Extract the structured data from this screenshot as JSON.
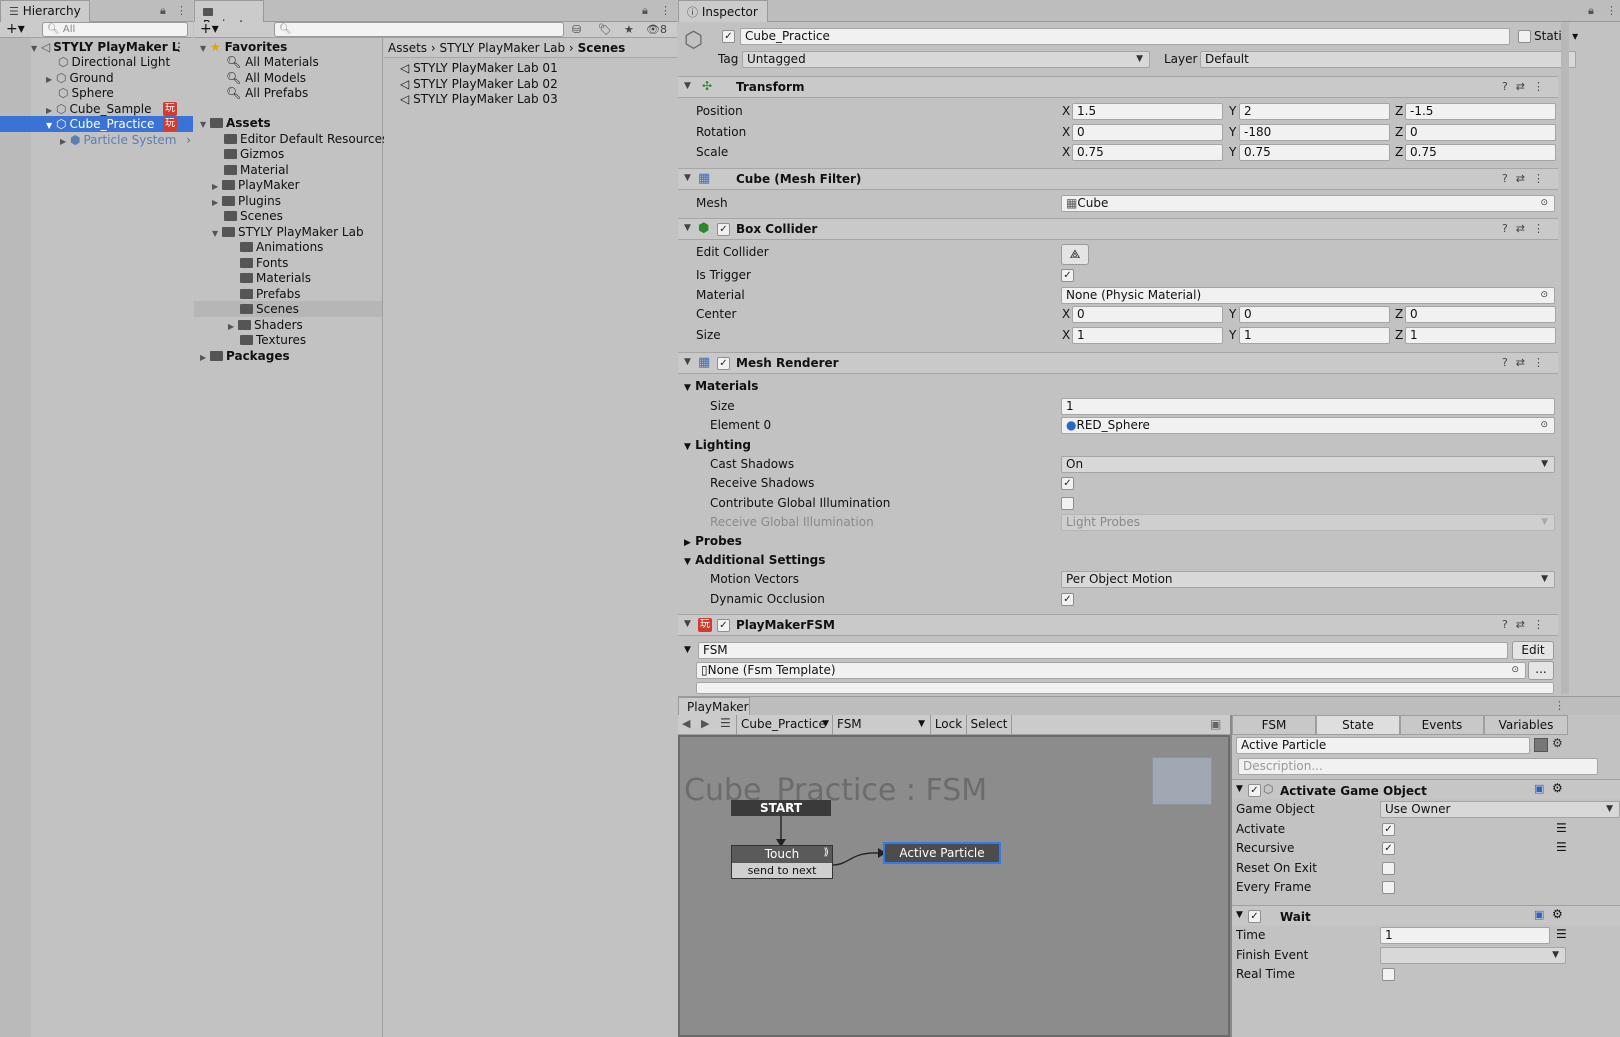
{
  "hierarchy": {
    "tab": "Hierarchy",
    "search_placeholder": "All",
    "items": [
      {
        "label": "STYLY PlayMaker L"
      },
      {
        "label": "Directional Light"
      },
      {
        "label": "Ground"
      },
      {
        "label": "Sphere"
      },
      {
        "label": "Cube_Sample",
        "badge": "玩"
      },
      {
        "label": "Cube_Practice",
        "badge": "玩"
      },
      {
        "label": "Particle System"
      }
    ]
  },
  "project": {
    "tab": "Project",
    "hidden_count": "8",
    "favorites": {
      "label": "Favorites",
      "items": [
        "All Materials",
        "All Models",
        "All Prefabs"
      ]
    },
    "assets": {
      "label": "Assets",
      "items": [
        "Editor Default Resources",
        "Gizmos",
        "Material",
        "PlayMaker",
        "Plugins",
        "Scenes",
        "STYLY PlayMaker Lab"
      ],
      "lab_children": [
        "Animations",
        "Fonts",
        "Materials",
        "Prefabs",
        "Scenes",
        "Shaders",
        "Textures"
      ]
    },
    "packages": "Packages",
    "breadcrumb": [
      "Assets",
      "STYLY PlayMaker Lab",
      "Scenes"
    ],
    "files": [
      "STYLY PlayMaker Lab 01",
      "STYLY PlayMaker Lab 02",
      "STYLY PlayMaker Lab 03"
    ]
  },
  "inspector": {
    "tab": "Inspector",
    "object_name": "Cube_Practice",
    "static_label": "Static",
    "tag_label": "Tag",
    "tag_value": "Untagged",
    "layer_label": "Layer",
    "layer_value": "Default",
    "transform": {
      "title": "Transform",
      "position_label": "Position",
      "rotation_label": "Rotation",
      "scale_label": "Scale",
      "position": [
        "1.5",
        "2",
        "-1.5"
      ],
      "rotation": [
        "0",
        "-180",
        "0"
      ],
      "scale": [
        "0.75",
        "0.75",
        "0.75"
      ]
    },
    "mesh_filter": {
      "title": "Cube (Mesh Filter)",
      "mesh_label": "Mesh",
      "mesh_value": "Cube"
    },
    "box_collider": {
      "title": "Box Collider",
      "edit_label": "Edit Collider",
      "trigger_label": "Is Trigger",
      "material_label": "Material",
      "material_value": "None (Physic Material)",
      "center_label": "Center",
      "center": [
        "0",
        "0",
        "0"
      ],
      "size_label": "Size",
      "size": [
        "1",
        "1",
        "1"
      ]
    },
    "mesh_renderer": {
      "title": "Mesh Renderer",
      "materials": "Materials",
      "size_label": "Size",
      "size_value": "1",
      "element_label": "Element 0",
      "element_value": "RED_Sphere",
      "lighting": "Lighting",
      "cast_label": "Cast Shadows",
      "cast_value": "On",
      "receive_label": "Receive Shadows",
      "contribute_label": "Contribute Global Illumination",
      "rgi_label": "Receive Global Illumination",
      "rgi_value": "Light Probes",
      "probes": "Probes",
      "additional": "Additional Settings",
      "motion_label": "Motion Vectors",
      "motion_value": "Per Object Motion",
      "dynamic_label": "Dynamic Occlusion"
    },
    "playmaker_fsm": {
      "title": "PlayMakerFSM",
      "fsm_value": "FSM",
      "edit_button": "Edit",
      "template_value": "None (Fsm Template)",
      "more_button": "..."
    }
  },
  "playmaker": {
    "tab": "PlayMaker",
    "object_select": "Cube_Practice",
    "fsm_select": "FSM",
    "lock": "Lock",
    "select": "Select",
    "graph_title": "Cube_Practice : FSM",
    "start": "START",
    "touch_state": "Touch",
    "touch_event": "send to next",
    "active_state": "Active Particle",
    "tabs": [
      "FSM",
      "State",
      "Events",
      "Variables"
    ],
    "state_name": "Active Particle",
    "description_placeholder": "Description...",
    "action1": {
      "title": "Activate Game Object",
      "game_object_label": "Game Object",
      "game_object_value": "Use Owner",
      "activate_label": "Activate",
      "recursive_label": "Recursive",
      "reset_label": "Reset On Exit",
      "every_label": "Every Frame"
    },
    "action2": {
      "title": "Wait",
      "time_label": "Time",
      "time_value": "1",
      "finish_label": "Finish Event",
      "real_label": "Real Time"
    }
  }
}
